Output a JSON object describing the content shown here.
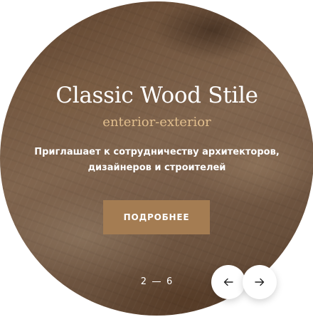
{
  "hero": {
    "title": "Classic Wood Stile",
    "subtitle": "enterior-exterior",
    "tagline_line1": "Приглашает к сотрудничеству архитекторов,",
    "tagline_line2": "дизайнеров и строителей",
    "button_label": "ПОДРОБНЕЕ"
  },
  "slider": {
    "current": "2",
    "total": "6",
    "prev_icon": "arrow-left-icon",
    "next_icon": "arrow-right-icon"
  },
  "colors": {
    "accent_button": "#a47c52",
    "subtitle": "#e2bf8e",
    "text": "#ffffff",
    "background": "#ffffff"
  }
}
